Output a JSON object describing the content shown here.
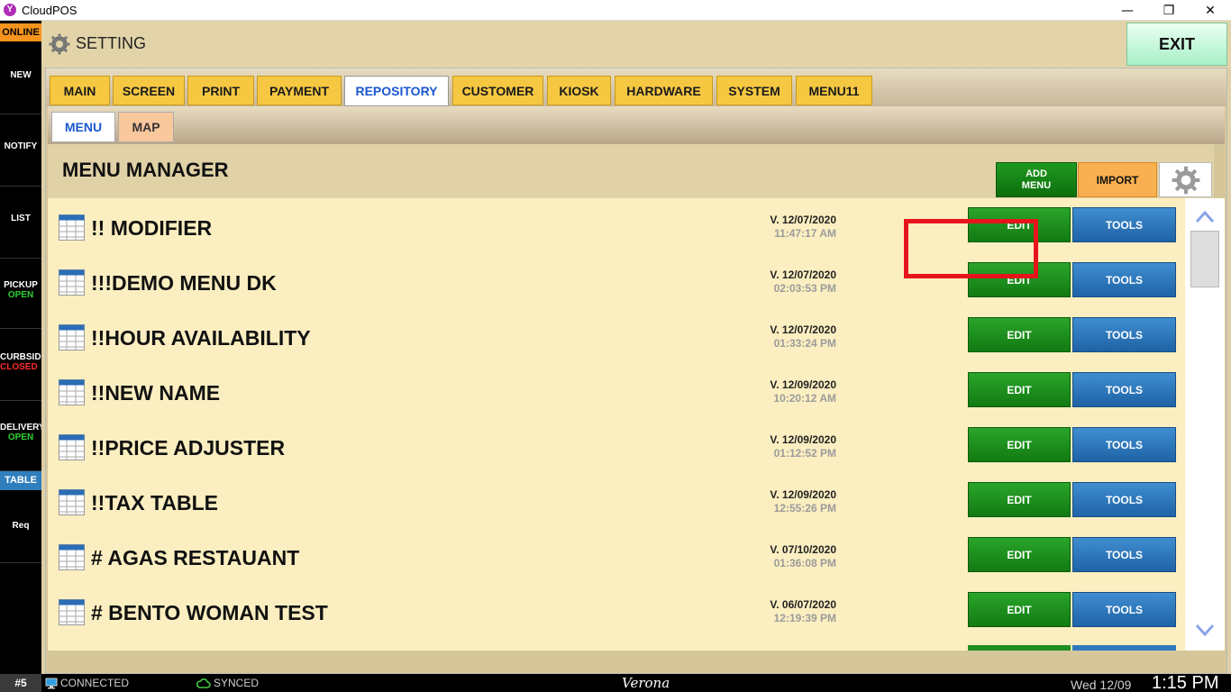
{
  "window": {
    "title": "CloudPOS",
    "app_icon_letter": "Y",
    "minimize": "—",
    "maximize": "❐",
    "close": "✕"
  },
  "sidebar": {
    "status": "ONLINE",
    "items": [
      {
        "label": "NEW",
        "sub": ""
      },
      {
        "label": "NOTIFY",
        "sub": ""
      },
      {
        "label": "LIST",
        "sub": ""
      },
      {
        "label": "PICKUP",
        "sub": "OPEN"
      },
      {
        "label": "CURBSIDE",
        "sub": "CLOSED"
      },
      {
        "label": "DELIVERY",
        "sub": "OPEN"
      }
    ],
    "table": "TABLE",
    "req": "Req"
  },
  "header": {
    "title": "SETTING",
    "exit_label": "EXIT"
  },
  "tabs": [
    {
      "label": "MAIN",
      "active": false
    },
    {
      "label": "SCREEN",
      "active": false
    },
    {
      "label": "PRINT",
      "active": false
    },
    {
      "label": "PAYMENT",
      "active": false
    },
    {
      "label": "REPOSITORY",
      "active": true
    },
    {
      "label": "CUSTOMER",
      "active": false
    },
    {
      "label": "KIOSK",
      "active": false
    },
    {
      "label": "HARDWARE",
      "active": false
    },
    {
      "label": "SYSTEM",
      "active": false
    },
    {
      "label": "MENU11",
      "active": false
    }
  ],
  "subtabs": [
    {
      "label": "MENU",
      "active": true
    },
    {
      "label": "MAP",
      "active": false
    }
  ],
  "menu_manager": {
    "title": "MENU MANAGER",
    "add_menu_line1": "ADD",
    "add_menu_line2": "MENU",
    "import_label": "IMPORT",
    "edit_label": "EDIT",
    "tools_label": "TOOLS",
    "rows": [
      {
        "name": "!! MODIFIER",
        "version": "V. 12/07/2020",
        "time": "11:47:17 AM"
      },
      {
        "name": "!!!DEMO MENU DK",
        "version": "V. 12/07/2020",
        "time": "02:03:53 PM"
      },
      {
        "name": "!!HOUR AVAILABILITY",
        "version": "V. 12/07/2020",
        "time": "01:33:24 PM"
      },
      {
        "name": "!!NEW NAME",
        "version": "V. 12/09/2020",
        "time": "10:20:12 AM"
      },
      {
        "name": "!!PRICE ADJUSTER",
        "version": "V. 12/09/2020",
        "time": "01:12:52 PM"
      },
      {
        "name": "!!TAX TABLE",
        "version": "V. 12/09/2020",
        "time": "12:55:26 PM"
      },
      {
        "name": "# AGAS RESTAUANT",
        "version": "V. 07/10/2020",
        "time": "01:36:08 PM"
      },
      {
        "name": "# BENTO WOMAN TEST",
        "version": "V. 06/07/2020",
        "time": "12:19:39 PM"
      }
    ]
  },
  "statusbar": {
    "station": "#5",
    "connected": "CONNECTED",
    "synced": "SYNCED",
    "store": "Verona",
    "date": "Wed 12/09",
    "time": "1:15 PM"
  }
}
